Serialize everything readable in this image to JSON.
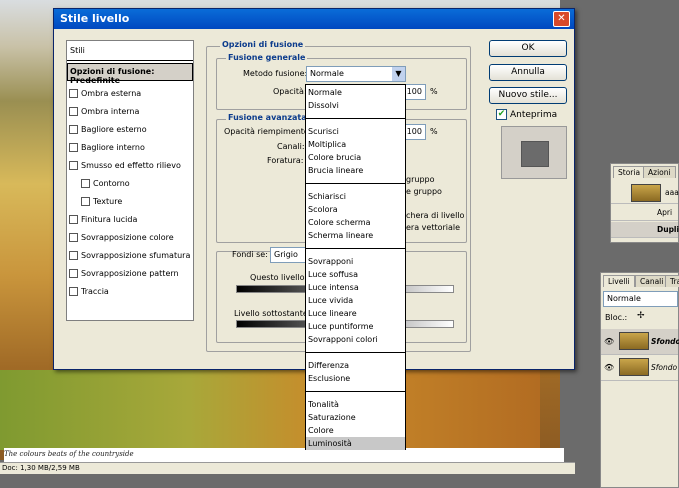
{
  "background": {
    "caption": "The colours beats of the countryside",
    "status": "Doc: 1,30 MB/2,59 MB"
  },
  "dialog": {
    "title": "Stile livello",
    "close_icon": "close-icon",
    "styles_header": "Stili",
    "styles_selected": "Opzioni di fusione: Predefinite",
    "styles": [
      {
        "label": "Ombra esterna",
        "indent": false
      },
      {
        "label": "Ombra interna",
        "indent": false
      },
      {
        "label": "Bagliore esterno",
        "indent": false
      },
      {
        "label": "Bagliore interno",
        "indent": false
      },
      {
        "label": "Smusso ed effetto rilievo",
        "indent": false
      },
      {
        "label": "Contorno",
        "indent": true
      },
      {
        "label": "Texture",
        "indent": true
      },
      {
        "label": "Finitura lucida",
        "indent": false
      },
      {
        "label": "Sovrapposizione colore",
        "indent": false
      },
      {
        "label": "Sovrapposizione sfumatura",
        "indent": false
      },
      {
        "label": "Sovrapposizione pattern",
        "indent": false
      },
      {
        "label": "Traccia",
        "indent": false
      }
    ],
    "section_title": "Opzioni di fusione",
    "general": {
      "title": "Fusione generale",
      "method_label": "Metodo fusione:",
      "method_value": "Normale",
      "opacity_label": "Opacità:",
      "opacity_value": "100",
      "percent": "%"
    },
    "advanced": {
      "title": "Fusione avanzata",
      "fill_label": "Opacità riempimento:",
      "fill_value": "100",
      "percent": "%",
      "channels_label": "Canali:",
      "knockout_label": "Foratura:",
      "partial_texts": [
        "gruppo",
        "e gruppo",
        "chera di livello",
        "era vettoriale"
      ]
    },
    "blendif": {
      "label": "Fondi se:",
      "value": "Grigio",
      "this_layer": "Questo livello:",
      "underlying": "Livello sottostante:"
    },
    "buttons": {
      "ok": "OK",
      "cancel": "Annulla",
      "new_style": "Nuovo stile...",
      "preview": "Anteprima"
    }
  },
  "dropdown": {
    "groups": [
      [
        "Normale",
        "Dissolvi"
      ],
      [
        "Scurisci",
        "Moltiplica",
        "Colore brucia",
        "Brucia lineare"
      ],
      [
        "Schiarisci",
        "Scolora",
        "Colore scherma",
        "Scherma lineare"
      ],
      [
        "Sovrapponi",
        "Luce soffusa",
        "Luce intensa",
        "Luce vivida",
        "Luce lineare",
        "Luce puntiforme",
        "Sovrapponi colori"
      ],
      [
        "Differenza",
        "Esclusione"
      ],
      [
        "Tonalità",
        "Saturazione",
        "Colore",
        "Luminosità"
      ]
    ],
    "highlighted": "Luminosità"
  },
  "storia": {
    "tabs": [
      "Storia",
      "Azioni"
    ],
    "file": "aaa.jp",
    "items": [
      "Apri",
      "Dupli"
    ]
  },
  "livelli": {
    "tabs": [
      "Livelli",
      "Canali",
      "Tracc"
    ],
    "mode": "Normale",
    "lock_label": "Bloc.:",
    "layers": [
      "Sfondo",
      "Sfondo"
    ]
  }
}
